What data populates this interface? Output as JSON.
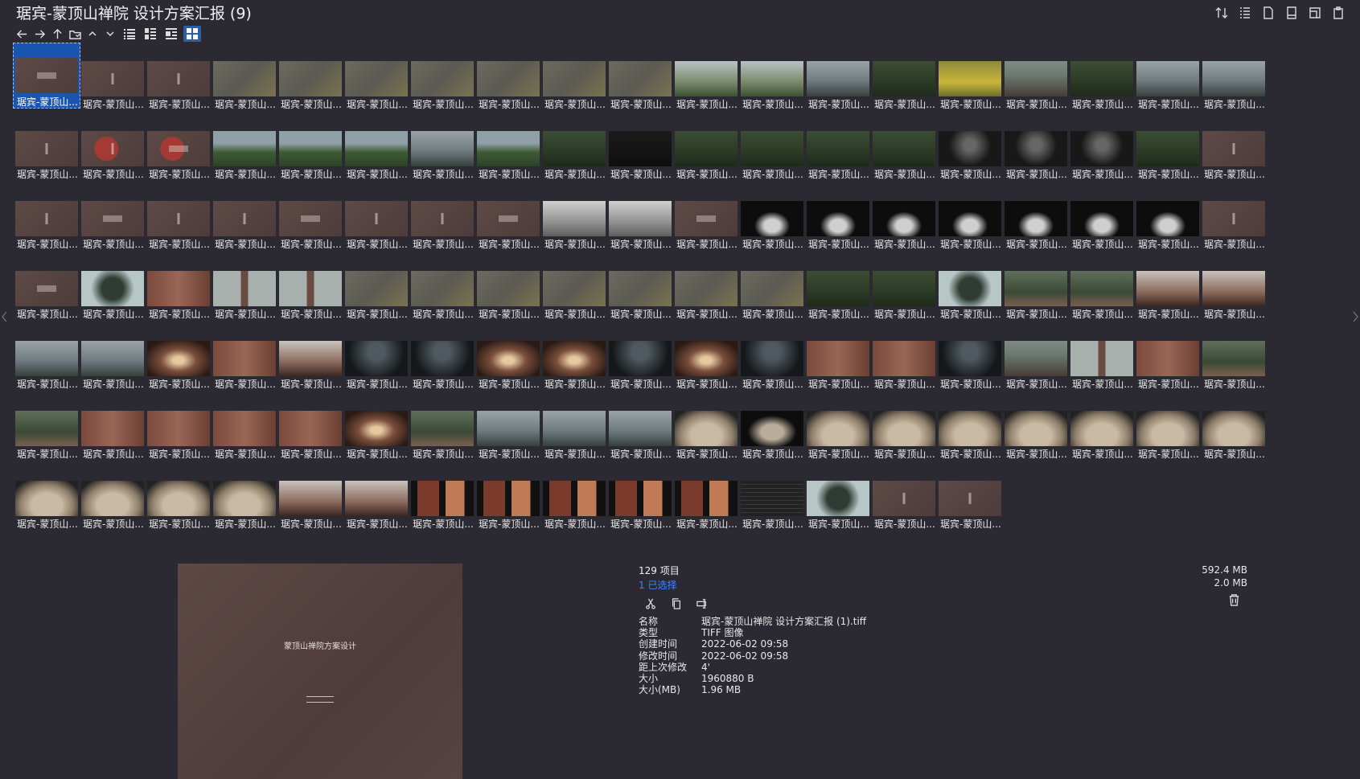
{
  "window": {
    "title": "琚宾-蒙顶山禅院 设计方案汇报 (9)"
  },
  "toolbar": {
    "top_icons": [
      "sort-icon",
      "details-list-icon",
      "file-icon",
      "new-file-icon",
      "new-window-icon",
      "clipboard-icon"
    ],
    "nav_icons": [
      "back-arrow-icon",
      "forward-arrow-icon",
      "up-arrow-icon",
      "open-folder-icon",
      "chevron-up-icon",
      "chevron-down-icon"
    ],
    "view_icons": [
      "list-view-icon",
      "details-view-icon",
      "tiles-view-icon",
      "thumbnails-view-icon"
    ],
    "active_view": "thumbnails-view-icon"
  },
  "grid": {
    "item_label": "琚宾-蒙顶山...",
    "columns": 19,
    "selected_index": 0,
    "thumbs": [
      "brown",
      "brown",
      "brown",
      "map",
      "map",
      "map",
      "map",
      "map",
      "map",
      "map",
      "green2",
      "green2",
      "mist",
      "forest",
      "yellow",
      "courtyard",
      "forest",
      "mist",
      "mist",
      "brown",
      "brown-red",
      "brown-red",
      "green",
      "green",
      "green",
      "mist",
      "green",
      "forest",
      "dark",
      "forest",
      "forest",
      "forest",
      "forest",
      "darkfog",
      "darkfog",
      "darkfog",
      "forest",
      "brown",
      "brown",
      "brown",
      "brown",
      "brown",
      "brown",
      "brown",
      "brown",
      "brown",
      "model",
      "model",
      "brown",
      "blackobj",
      "blackobj",
      "blackobj",
      "blackobj",
      "blackobj",
      "blackobj",
      "blackobj",
      "brown",
      "brown",
      "tree",
      "wall",
      "pillar",
      "pillar",
      "map",
      "map",
      "map",
      "map",
      "map",
      "map",
      "map",
      "forest",
      "forest",
      "tree",
      "canopy",
      "canopy",
      "room",
      "room",
      "mist",
      "mist",
      "corridor",
      "wall",
      "room",
      "dim",
      "dim",
      "corridor",
      "corridor",
      "dim",
      "corridor",
      "dim",
      "wall",
      "wall",
      "dim",
      "courtyard",
      "pillar",
      "wall",
      "canopy",
      "canopy",
      "wall",
      "wall",
      "wall",
      "wall",
      "corridor",
      "canopy",
      "mist",
      "mist",
      "mist",
      "rock",
      "rockdark",
      "rock",
      "rock",
      "rock",
      "rock",
      "rock",
      "rock",
      "rock",
      "rock",
      "rock",
      "rock",
      "rock",
      "room",
      "room",
      "slides",
      "slides",
      "slides",
      "slides",
      "slides",
      "table",
      "tree",
      "brown",
      "brown"
    ]
  },
  "preview": {
    "title": "蒙顶山禅院方案设计"
  },
  "info": {
    "count": "129 项目",
    "selected": "1 已选择",
    "action_icons": [
      "cut-icon",
      "copy-icon",
      "rename-icon"
    ],
    "props": [
      {
        "k": "名称",
        "v": "琚宾-蒙顶山禅院 设计方案汇报 (1).tiff"
      },
      {
        "k": "类型",
        "v": "TIFF 图像"
      },
      {
        "k": "创建时间",
        "v": "2022-06-02  09:58"
      },
      {
        "k": "修改时间",
        "v": "2022-06-02  09:58"
      },
      {
        "k": "距上次修改",
        "v": "4'"
      },
      {
        "k": "大小",
        "v": "1960880 B"
      },
      {
        "k": "大小(MB)",
        "v": "1.96 MB"
      }
    ],
    "total_size": "592.4 MB",
    "selected_size": "2.0 MB"
  }
}
